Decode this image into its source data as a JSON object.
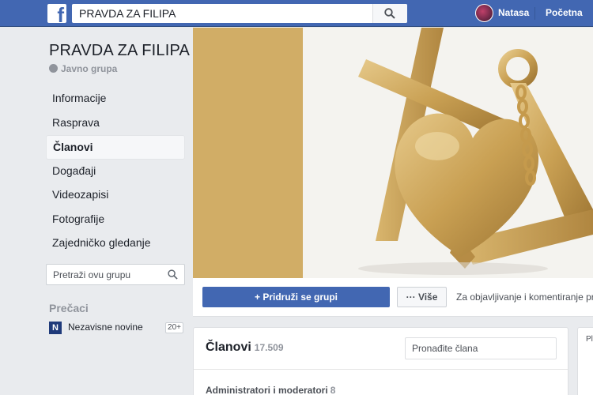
{
  "topbar": {
    "logo": "facebook-logo",
    "search_value": "PRAVDA ZA FILIPA",
    "user_name": "Natasa",
    "home_label": "Početna"
  },
  "group": {
    "title": "PRAVDA ZA FILIPA",
    "privacy": "Javno grupa"
  },
  "sidebar": {
    "items": [
      {
        "label": "Informacije",
        "active": false
      },
      {
        "label": "Rasprava",
        "active": false
      },
      {
        "label": "Članovi",
        "active": true
      },
      {
        "label": "Događaji",
        "active": false
      },
      {
        "label": "Videozapisi",
        "active": false
      },
      {
        "label": "Fotografije",
        "active": false
      },
      {
        "label": "Zajedničko gledanje",
        "active": false
      }
    ],
    "search_placeholder": "Pretraži ovu grupu",
    "shortcuts_title": "Prečaci",
    "shortcut": {
      "icon_text": "N",
      "label": "Nezavisne novine",
      "count": "20+"
    }
  },
  "actions": {
    "join_label": "Pridruži se grupi",
    "more_label": "Više",
    "post_note": "Za objavljivanje i komentiranje prid"
  },
  "members": {
    "title": "Članovi",
    "count": "17.509",
    "search_placeholder": "Pronađite člana",
    "admins_label": "Administratori i moderatori",
    "admins_count": "8"
  },
  "side_card": {
    "label": "Pl"
  },
  "colors": {
    "brand_blue": "#4267b2",
    "background": "#e9ebee",
    "cover_gold": "#d1ad66"
  }
}
